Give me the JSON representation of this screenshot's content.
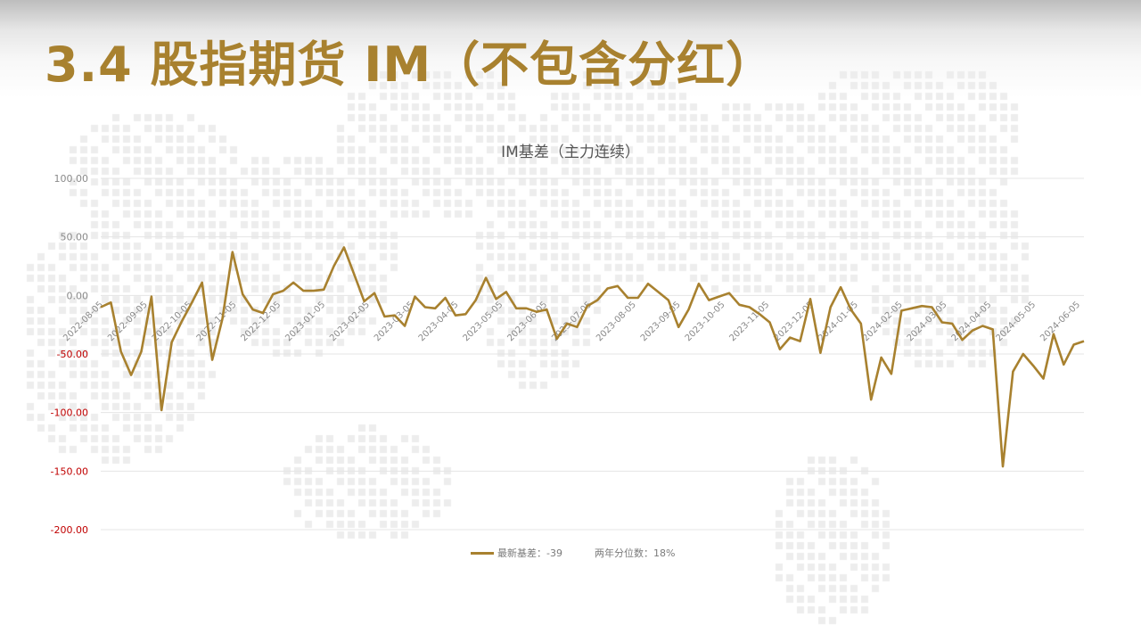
{
  "slide": {
    "title": "3.4 股指期货 IM（不包含分红）"
  },
  "colors": {
    "accent": "#a8812f",
    "negative_tick": "#c00000",
    "positive_tick": "#8a8a8a",
    "grid": "#e4e4e4"
  },
  "legend": {
    "series_label": "最新基差：-39",
    "percentile_label": "两年分位数：18%"
  },
  "chart_data": {
    "type": "line",
    "title": "IM基差（主力连续）",
    "xlabel": "",
    "ylabel": "",
    "ylim": [
      -200,
      100
    ],
    "y_ticks": [
      100,
      50,
      0,
      -50,
      -100,
      -150,
      -200
    ],
    "y_tick_labels": [
      "100.00",
      "50.00",
      "0.00",
      "-50.00",
      "-100.00",
      "-150.00",
      "-200.00"
    ],
    "x_tick_labels": [
      "2022-08-05",
      "2022-09-05",
      "2022-10-05",
      "2022-11-05",
      "2022-12-05",
      "2023-01-05",
      "2023-02-05",
      "2023-03-05",
      "2023-04-05",
      "2023-05-05",
      "2023-06-05",
      "2023-07-05",
      "2023-08-05",
      "2023-09-05",
      "2023-10-05",
      "2023-11-05",
      "2023-12-05",
      "2024-01-05",
      "2024-02-05",
      "2024-03-05",
      "2024-04-05",
      "2024-05-05",
      "2024-06-05"
    ],
    "grid": true,
    "legend_position": "bottom",
    "series": [
      {
        "name": "最新基差：-39",
        "values": [
          -10,
          -6,
          -48,
          -68,
          -48,
          -1,
          -98,
          -40,
          -22,
          -6,
          11,
          -55,
          -20,
          37,
          1,
          -12,
          -15,
          1,
          4,
          11,
          4,
          4,
          5,
          25,
          41,
          18,
          -5,
          2,
          -18,
          -17,
          -26,
          -1,
          -10,
          -11,
          -2,
          -17,
          -16,
          -4,
          15,
          -3,
          3,
          -11,
          -11,
          -14,
          -12,
          -37,
          -24,
          -27,
          -9,
          -4,
          6,
          8,
          -2,
          -2,
          10,
          3,
          -4,
          -27,
          -12,
          10,
          -4,
          -1,
          2,
          -8,
          -10,
          -16,
          -23,
          -46,
          -36,
          -39,
          -3,
          -49,
          -10,
          7,
          -12,
          -24,
          -89,
          -53,
          -67,
          -13,
          -11,
          -9,
          -10,
          -23,
          -24,
          -38,
          -30,
          -26,
          -29,
          -146,
          -65,
          -50,
          -60,
          -71,
          -33,
          -59,
          -42,
          -39
        ]
      }
    ]
  }
}
